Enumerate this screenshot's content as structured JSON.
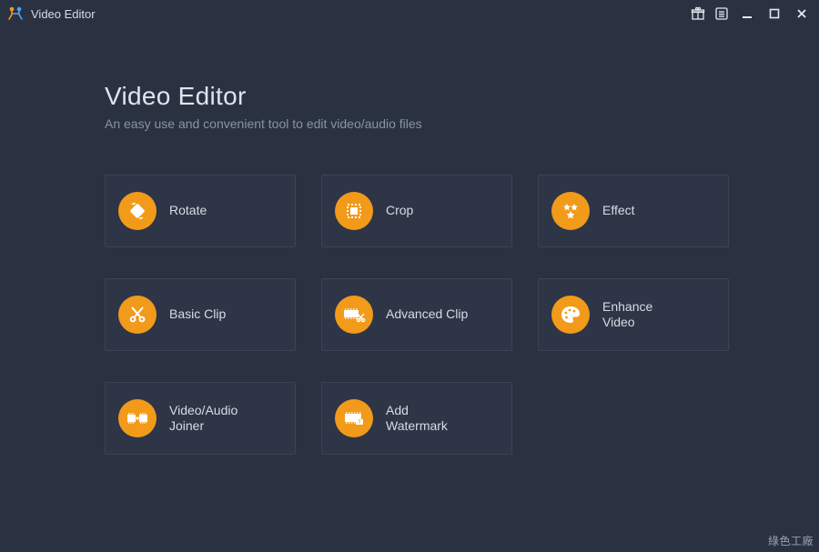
{
  "titlebar": {
    "app_title": "Video Editor"
  },
  "page": {
    "heading": "Video Editor",
    "subheading": "An easy use and convenient tool to edit video/audio files"
  },
  "tiles": {
    "rotate": {
      "label": "Rotate"
    },
    "crop": {
      "label": "Crop"
    },
    "effect": {
      "label": "Effect"
    },
    "basic_clip": {
      "label": "Basic Clip"
    },
    "advanced_clip": {
      "label": "Advanced Clip"
    },
    "enhance_video": {
      "label": "Enhance\nVideo"
    },
    "joiner": {
      "label": "Video/Audio\nJoiner"
    },
    "watermark": {
      "label": "Add\nWatermark"
    }
  },
  "footer": {
    "watermark_text": "綠色工廠"
  },
  "colors": {
    "accent": "#f29a1a",
    "bg": "#2a3242",
    "tile_border": "#3b4456"
  }
}
